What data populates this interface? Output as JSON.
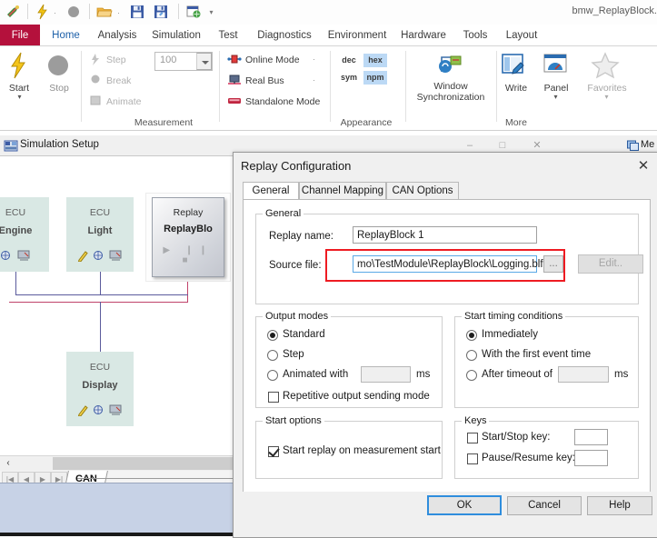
{
  "quick_access": {
    "icons": [
      "app-icon",
      "lightning-icon",
      "stop-icon",
      "open-folder-icon",
      "save-icon",
      "save-as-icon",
      "export-icon"
    ],
    "overflow_label": "¯"
  },
  "titlebar": {
    "document_title": "bmw_ReplayBlock."
  },
  "ribbon": {
    "tabs": [
      {
        "label": "File",
        "kind": "file"
      },
      {
        "label": "Home",
        "kind": "active"
      },
      {
        "label": "Analysis",
        "kind": "normal"
      },
      {
        "label": "Simulation",
        "kind": "normal"
      },
      {
        "label": "Test",
        "kind": "normal"
      },
      {
        "label": "Diagnostics",
        "kind": "normal"
      },
      {
        "label": "Environment",
        "kind": "normal"
      },
      {
        "label": "Hardware",
        "kind": "normal"
      },
      {
        "label": "Tools",
        "kind": "normal"
      },
      {
        "label": "Layout",
        "kind": "normal"
      }
    ],
    "groups": {
      "measurement": {
        "title": "Measurement",
        "start_label": "Start",
        "stop_label": "Stop",
        "step_label": "Step",
        "break_label": "Break",
        "animate_label": "Animate",
        "step_value": "100",
        "online_mode_label": "Online Mode",
        "real_bus_label": "Real Bus",
        "standalone_mode_label": "Standalone Mode"
      },
      "appearance": {
        "title": "Appearance",
        "radix": [
          {
            "label": "dec",
            "selected": false
          },
          {
            "label": "hex",
            "selected": true
          },
          {
            "label": "sym",
            "selected": false
          },
          {
            "label": "npm",
            "selected": true
          }
        ]
      },
      "more": {
        "title": "More",
        "window_sync_line1": "Window",
        "window_sync_line2": "Synchronization",
        "write_label": "Write",
        "panel_label": "Panel",
        "favorites_label": "Favorites"
      }
    }
  },
  "sim_window": {
    "title": "Simulation Setup",
    "minimize": "–",
    "maximize": "□",
    "close": "✕",
    "nodes": [
      {
        "kind": "ECU",
        "name": "Engine"
      },
      {
        "kind": "ECU",
        "name": "Light"
      },
      {
        "kind": "ECU",
        "name": "Display"
      }
    ],
    "replay_node": {
      "kind": "Replay",
      "name": "ReplayBlo",
      "transport": "▶ ❙❙ ■"
    },
    "bus_tab": "CAN",
    "scroll_left_glyph": "‹",
    "nav_first": "|◀",
    "nav_prev": "◀",
    "nav_next": "▶",
    "nav_last": "▶|"
  },
  "mdi_peek": {
    "label": "Me"
  },
  "dialog": {
    "title": "Replay Configuration",
    "close_glyph": "✕",
    "tabs": [
      {
        "label": "General",
        "active": true
      },
      {
        "label": "Channel Mapping",
        "active": false
      },
      {
        "label": "CAN Options",
        "active": false
      }
    ],
    "general_group": {
      "caption": "General",
      "replay_name_label": "Replay name:",
      "replay_name_value": "ReplayBlock 1",
      "source_file_label": "Source file:",
      "source_file_value": "mo\\TestModule\\ReplayBlock\\Logging.blf",
      "browse_label": "...",
      "edit_label": "Edit..",
      "highlight_color": "#ee1b22"
    },
    "output_modes": {
      "caption": "Output modes",
      "options": [
        {
          "label": "Standard",
          "selected": true
        },
        {
          "label": "Step",
          "selected": false
        },
        {
          "label": "Animated with",
          "selected": false
        }
      ],
      "animated_value": "",
      "animated_unit": "ms",
      "repetitive_label": "Repetitive output sending mode",
      "repetitive_checked": false
    },
    "start_timing": {
      "caption": "Start timing conditions",
      "options": [
        {
          "label": "Immediately",
          "selected": true
        },
        {
          "label": "With the first event time",
          "selected": false
        },
        {
          "label": "After timeout of",
          "selected": false
        }
      ],
      "timeout_value": "",
      "timeout_unit": "ms"
    },
    "start_options": {
      "caption": "Start options",
      "checkbox_label": "Start replay on measurement start",
      "checked": true
    },
    "keys": {
      "caption": "Keys",
      "rows": [
        {
          "label": "Start/Stop key:",
          "checked": false,
          "value": ""
        },
        {
          "label": "Pause/Resume key:",
          "checked": false,
          "value": ""
        }
      ]
    },
    "footer": {
      "ok_label": "OK",
      "cancel_label": "Cancel",
      "help_label": "Help"
    }
  }
}
